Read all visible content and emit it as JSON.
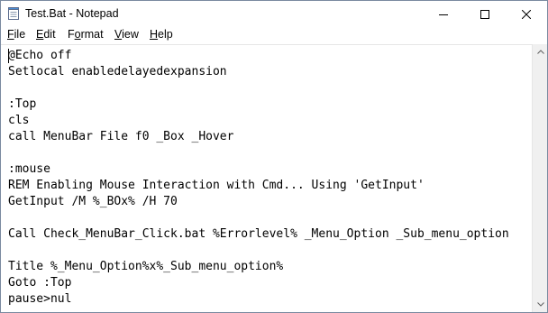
{
  "window": {
    "title": "Test.Bat - Notepad",
    "buttons": {
      "minimize_icon": "minimize-icon",
      "maximize_icon": "maximize-icon",
      "close_icon": "close-icon"
    }
  },
  "menubar": {
    "items": [
      {
        "accel": "F",
        "rest": "ile"
      },
      {
        "accel": "E",
        "rest": "dit"
      },
      {
        "pre": "F",
        "accel": "o",
        "rest": "rmat"
      },
      {
        "accel": "V",
        "rest": "iew"
      },
      {
        "accel": "H",
        "rest": "elp"
      }
    ]
  },
  "editor": {
    "lines": [
      "@Echo off",
      "Setlocal enabledelayedexpansion",
      "",
      ":Top",
      "cls",
      "call MenuBar File f0 _Box _Hover",
      "",
      ":mouse",
      "REM Enabling Mouse Interaction with Cmd... Using 'GetInput'",
      "GetInput /M %_BOx% /H 70",
      "",
      "Call Check_MenuBar_Click.bat %Errorlevel% _Menu_Option _Sub_menu_option",
      "",
      "Title %_Menu_Option%x%_Sub_menu_option%",
      "Goto :Top",
      "pause>nul"
    ]
  },
  "colors": {
    "window_border": "#7a8aa0",
    "text": "#000000",
    "scrollbar_bg": "#f0f0f0"
  }
}
